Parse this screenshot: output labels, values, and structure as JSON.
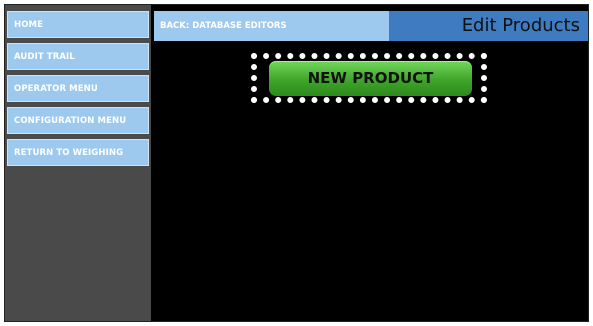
{
  "sidebar": {
    "items": [
      {
        "label": "HOME"
      },
      {
        "label": "AUDIT TRAIL"
      },
      {
        "label": "OPERATOR MENU"
      },
      {
        "label": "CONFIGURATION MENU"
      },
      {
        "label": "RETURN TO WEIGHING"
      }
    ]
  },
  "header": {
    "back_label": "BACK: DATABASE EDITORS",
    "title": "Edit Products"
  },
  "main": {
    "new_product_label": "NEW PRODUCT"
  },
  "colors": {
    "nav_button": "#9ec9ee",
    "title_bar": "#3f7bc0",
    "primary_button": "#3ea52a",
    "background": "#000000",
    "sidebar": "#4a4a4a"
  }
}
